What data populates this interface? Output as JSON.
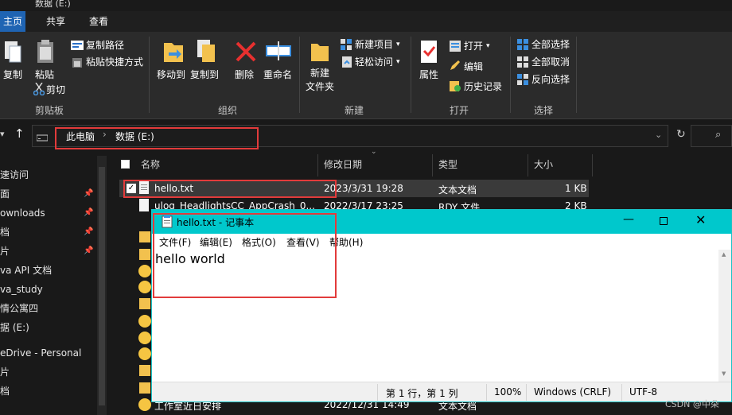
{
  "window": {
    "partial_title": "数据 (E:)"
  },
  "tabs": {
    "home": "主页",
    "share": "共享",
    "view": "查看"
  },
  "ribbon": {
    "clipboard": {
      "pin": "复制",
      "paste": "粘贴",
      "copy_path": "复制路径",
      "paste_shortcut": "粘贴快捷方式",
      "cut": "剪切",
      "group": "剪贴板"
    },
    "organize": {
      "move_to": "移动到",
      "copy_to": "复制到",
      "delete": "删除",
      "rename": "重命名",
      "group": "组织"
    },
    "new": {
      "new_folder_1": "新建",
      "new_folder_2": "文件夹",
      "new_item": "新建项目",
      "easy_access": "轻松访问",
      "group": "新建"
    },
    "open": {
      "properties": "属性",
      "open": "打开",
      "edit": "编辑",
      "history": "历史记录",
      "group": "打开"
    },
    "select": {
      "select_all": "全部选择",
      "select_none": "全部取消",
      "invert": "反向选择",
      "group": "选择"
    }
  },
  "address": {
    "this_pc": "此电脑",
    "separator": "›",
    "drive": "数据 (E:)"
  },
  "nav": {
    "items": [
      "速访问",
      "面",
      "ownloads",
      "档",
      "片",
      "va API 文档",
      "va_study",
      "情公寓四",
      "据 (E:)",
      "eDrive - Personal",
      "片",
      "档"
    ]
  },
  "columns": {
    "name": "名称",
    "modified": "修改日期",
    "type": "类型",
    "size": "大小"
  },
  "files": [
    {
      "name": "hello.txt",
      "modified": "2023/3/31 19:28",
      "type": "文本文档",
      "size": "1 KB"
    },
    {
      "name": "ulog_HeadlightsCC_AppCrash_0...",
      "modified": "2022/3/17 23:25",
      "type": "RDY 文件",
      "size": "2 KB"
    },
    {
      "name": "工作室近日安排",
      "modified": "2022/12/31 14:49",
      "type": "文本文档",
      "size": ""
    }
  ],
  "notepad": {
    "title": "hello.txt - 记事本",
    "menu": [
      "文件(F)",
      "编辑(E)",
      "格式(O)",
      "查看(V)",
      "帮助(H)"
    ],
    "content": "hello world",
    "status": {
      "position": "第 1 行，第 1 列",
      "zoom": "100%",
      "eol": "Windows (CRLF)",
      "encoding": "UTF-8"
    }
  },
  "watermark": "CSDN @中朵",
  "colors": {
    "accent": "#1f64b3",
    "notepad_title": "#00c8cc",
    "highlight": "#e23b3b"
  }
}
